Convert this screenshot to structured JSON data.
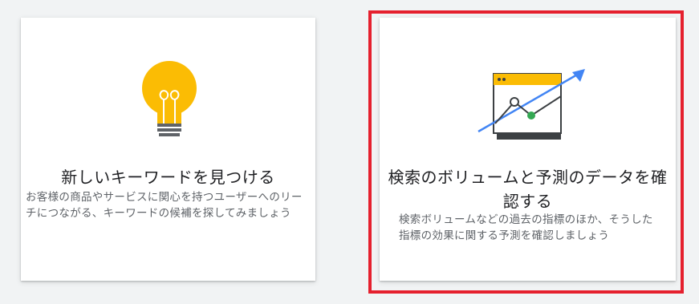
{
  "cards": [
    {
      "title": "新しいキーワードを見つける",
      "description": "お客様の商品やサービスに関心を持つユーザーへのリーチにつながる、キーワードの候補を探してみましょう",
      "icon": "lightbulb-icon",
      "accent": "#fbbc04"
    },
    {
      "title": "検索のボリュームと予測のデータを確認する",
      "description": "検索ボリュームなどの過去の指標のほか、そうした指標の効果に関する予測を確認しましょう",
      "icon": "trend-chart-icon",
      "highlight_color": "#e5202e"
    }
  ]
}
